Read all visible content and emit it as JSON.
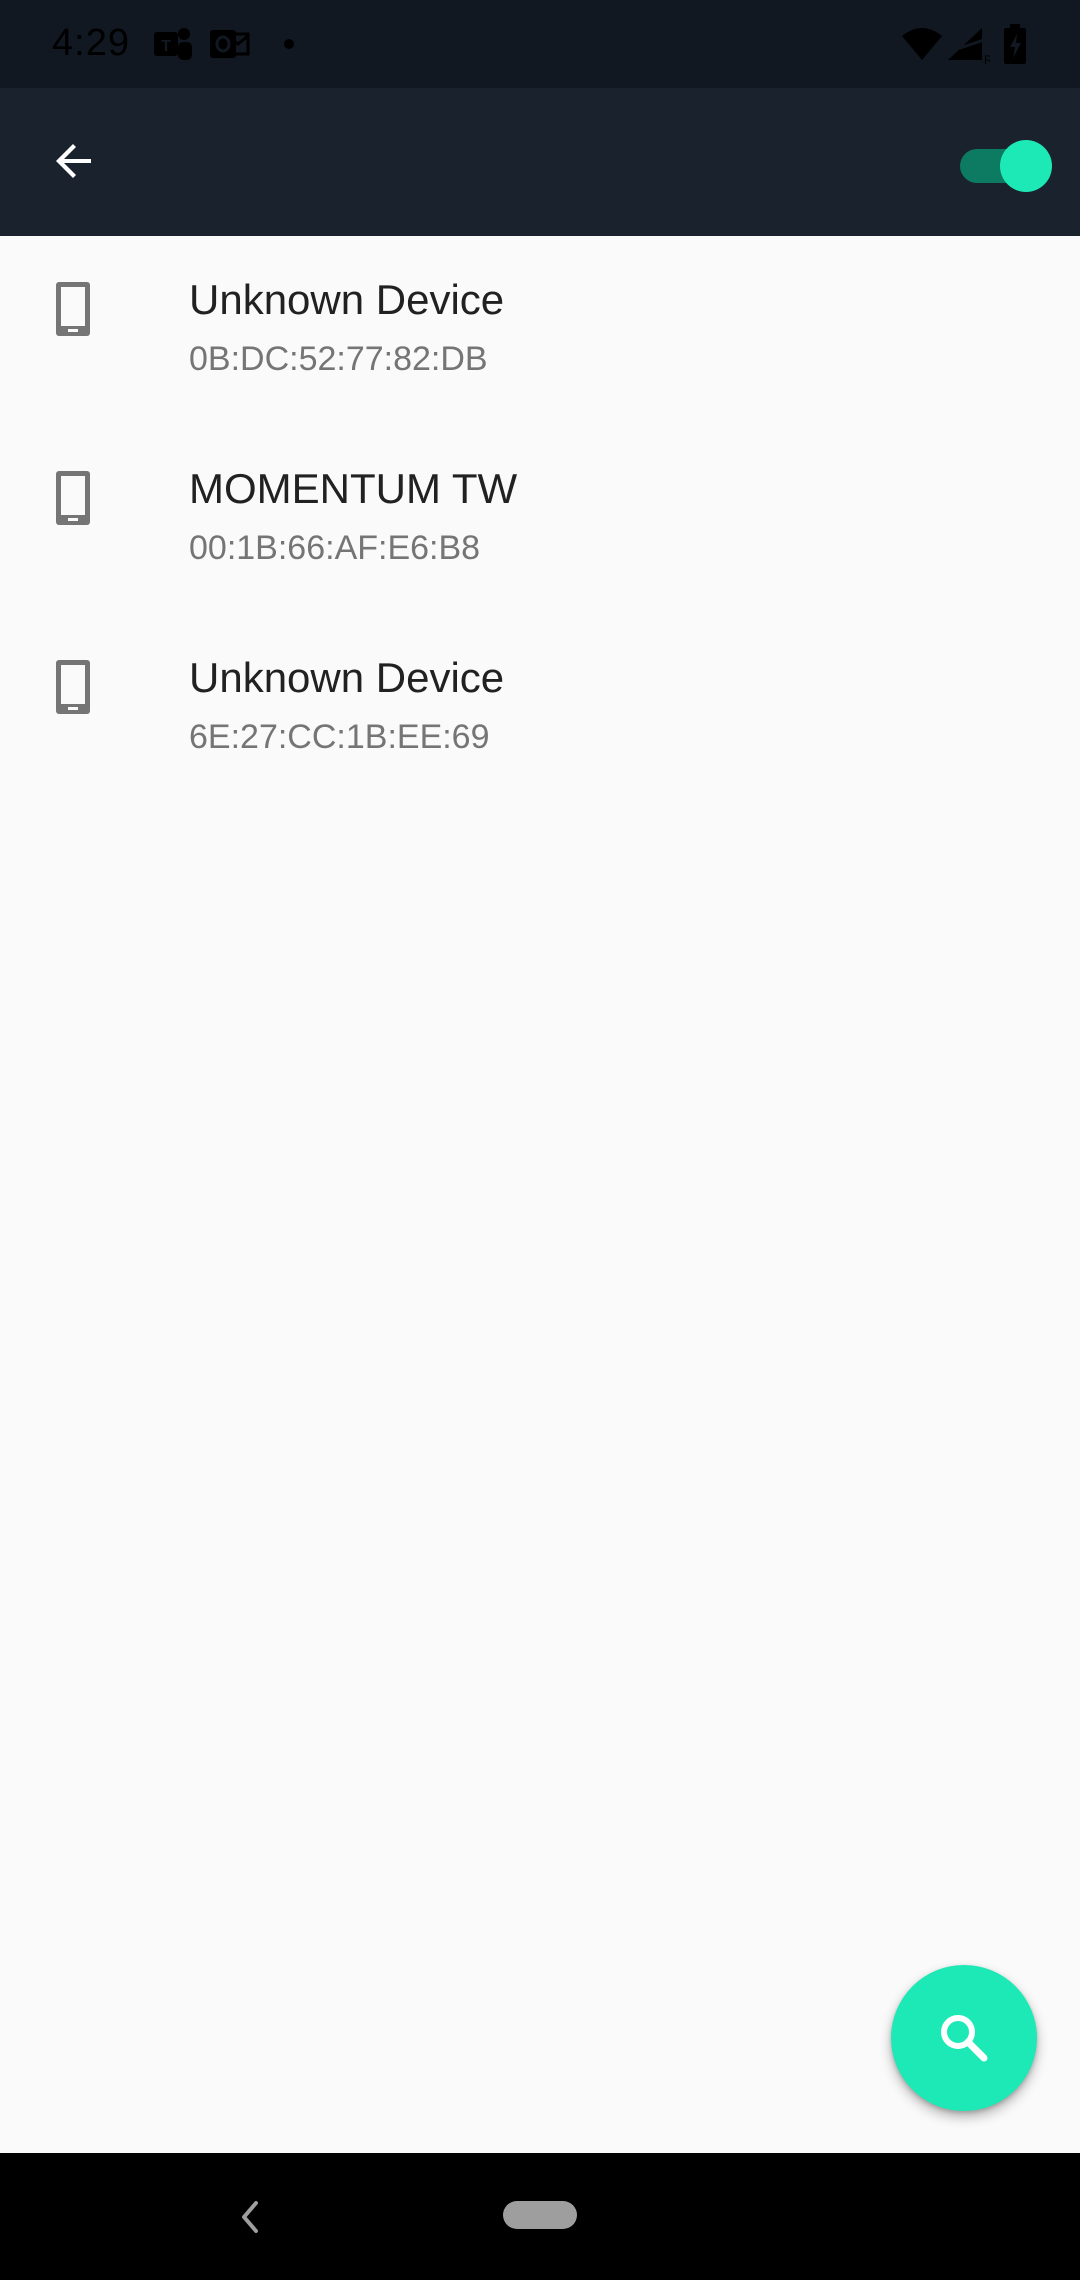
{
  "status_bar": {
    "time": "4:29",
    "left_icons": [
      "teams-icon",
      "outlook-icon",
      "notification-dot-icon"
    ],
    "right_icons": [
      "wifi-icon",
      "cell-signal-icon",
      "battery-icon"
    ]
  },
  "toolbar": {
    "back_icon": "arrow-back-icon",
    "bluetooth_toggle": {
      "state": "on",
      "track_color": "#0d7a62",
      "thumb_color": "#1de9b6"
    }
  },
  "devices": [
    {
      "name": "Unknown Device",
      "address": "0B:DC:52:77:82:DB",
      "icon": "smartphone-icon"
    },
    {
      "name": "MOMENTUM TW",
      "address": "00:1B:66:AF:E6:B8",
      "icon": "smartphone-icon"
    },
    {
      "name": "Unknown Device",
      "address": "6E:27:CC:1B:EE:69",
      "icon": "smartphone-icon"
    }
  ],
  "fab": {
    "icon": "search-icon",
    "color": "#1de9b6"
  },
  "nav_bar": {
    "back_icon": "nav-back-icon",
    "home_icon": "home-pill-icon"
  },
  "colors": {
    "toolbar": "#1a222d",
    "status_bar": "#111821",
    "background": "#fafafa",
    "accent": "#1de9b6"
  }
}
